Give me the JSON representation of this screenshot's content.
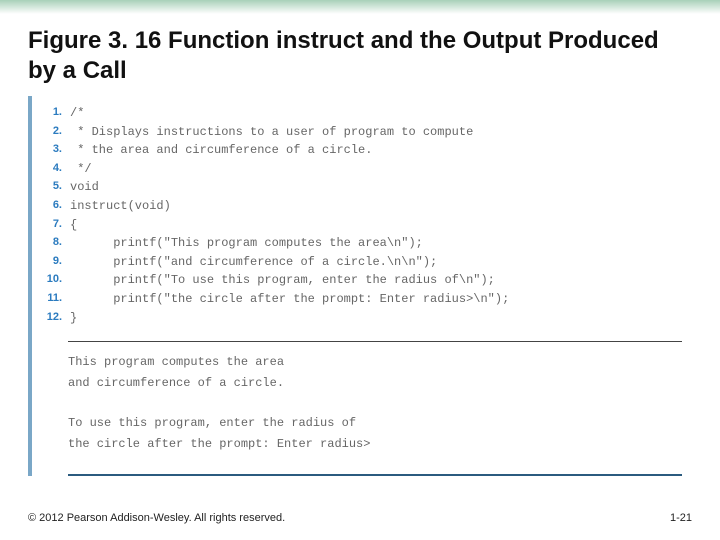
{
  "header": {
    "title_prefix": "Figure 3. 16",
    "title_rest": "  Function instruct and the Output Produced by a Call"
  },
  "code": {
    "lines": [
      {
        "n": "1.",
        "t": "/*"
      },
      {
        "n": "2.",
        "t": " * Displays instructions to a user of program to compute"
      },
      {
        "n": "3.",
        "t": " * the area and circumference of a circle."
      },
      {
        "n": "4.",
        "t": " */"
      },
      {
        "n": "5.",
        "t": "void"
      },
      {
        "n": "6.",
        "t": "instruct(void)"
      },
      {
        "n": "7.",
        "t": "{"
      },
      {
        "n": "8.",
        "t": "      printf(\"This program computes the area\\n\");"
      },
      {
        "n": "9.",
        "t": "      printf(\"and circumference of a circle.\\n\\n\");"
      },
      {
        "n": "10.",
        "t": "      printf(\"To use this program, enter the radius of\\n\");"
      },
      {
        "n": "11.",
        "t": "      printf(\"the circle after the prompt: Enter radius>\\n\");"
      },
      {
        "n": "12.",
        "t": "}"
      }
    ]
  },
  "output": {
    "lines": [
      "This program computes the area",
      "and circumference of a circle.",
      "",
      "To use this program, enter the radius of",
      "the circle after the prompt: Enter radius>"
    ]
  },
  "footer": {
    "copyright": "© 2012 Pearson Addison-Wesley. All rights reserved.",
    "page": "1-21"
  }
}
